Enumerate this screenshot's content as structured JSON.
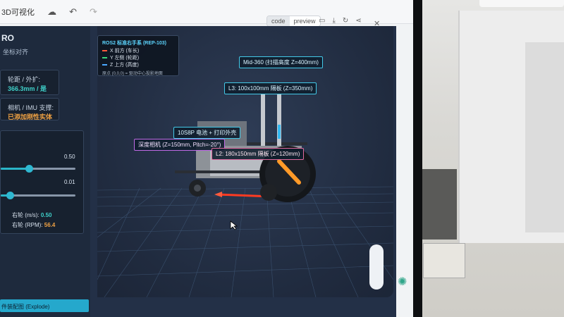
{
  "topbar": {
    "title": "3D可视化",
    "code_label": "code",
    "preview_label": "preview"
  },
  "left": {
    "title": "RO",
    "subtitle": "坐标对齐",
    "wheel_label": "轮距 / 外扩:",
    "wheel_value": "366.3mm / 是",
    "camera_label": "相机 / IMU 支撑:",
    "camera_value": "已添加刚性实体",
    "slider1_value": "0.50",
    "slider1_level": 0.38,
    "slider2_value": "0.01",
    "slider2_level": 0.12,
    "right_wheel_ms_label": "右轮 (m/s):",
    "right_wheel_ms_value": "0.50",
    "right_wheel_rpm_label": "右轮 (RPM):",
    "right_wheel_rpm_value": "56.4",
    "explode_label": "件装配图 (Explode)"
  },
  "legend": {
    "title": "ROS2 标准右手系 (REP-103)",
    "x": "X 前方 (车长)",
    "y": "Y 左侧 (轮距)",
    "z": "Z 上方 (高度)",
    "note": "原点 (0,0,0) = 驱动中心投影地面",
    "x_color": "#ff5a3c",
    "y_color": "#39d67a",
    "z_color": "#4aa8ff"
  },
  "tags": {
    "mid360": "Mid-360 (扫描高度 Z=400mm)",
    "l3": "L3: 100x100mm 隔板 (Z=350mm)",
    "battery": "10S8P 电池 + 打印外壳",
    "camera": "深度相机 (Z=150mm, Pitch=-20°)",
    "l2": "L2: 180x150mm 隔板 (Z=120mm)"
  }
}
